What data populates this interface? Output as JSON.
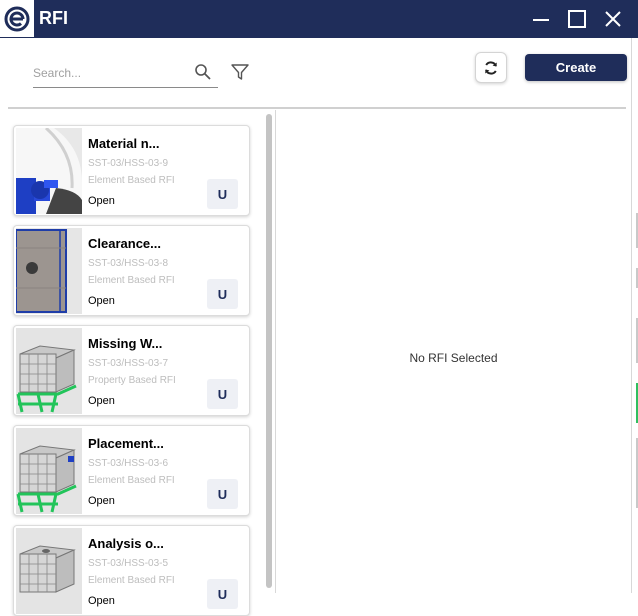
{
  "window": {
    "title": "RFI",
    "logo_icon": "e-logo-icon",
    "controls": [
      "minimize-icon",
      "maximize-icon",
      "close-icon"
    ],
    "titlebar_color": "#1f2d5a"
  },
  "toolbar": {
    "search_placeholder": "Search...",
    "search_value": "",
    "search_icon": "search-icon",
    "filter_icon": "filter-icon",
    "refresh_icon": "refresh-icon",
    "create_label": "Create",
    "accent_color": "#1f2d5a"
  },
  "rfi_list": [
    {
      "title": "Material n...",
      "code": "SST-03/HSS-03-9",
      "type": "Element Based RFI",
      "status": "Open",
      "badge": "U",
      "thumbnail": "valve-model"
    },
    {
      "title": "Clearance...",
      "code": "SST-03/HSS-03-8",
      "type": "Element Based RFI",
      "status": "Open",
      "badge": "U",
      "thumbnail": "tank-panel-model"
    },
    {
      "title": "Missing W...",
      "code": "SST-03/HSS-03-7",
      "type": "Property Based RFI",
      "status": "Open",
      "badge": "U",
      "thumbnail": "ibc-tote-model"
    },
    {
      "title": "Placement...",
      "code": "SST-03/HSS-03-6",
      "type": "Element Based RFI",
      "status": "Open",
      "badge": "U",
      "thumbnail": "ibc-tote-model"
    },
    {
      "title": "Analysis o...",
      "code": "SST-03/HSS-03-5",
      "type": "Element Based RFI",
      "status": "Open",
      "badge": "U",
      "thumbnail": "ibc-tote-model"
    }
  ],
  "detail": {
    "empty_message": "No RFI Selected"
  }
}
